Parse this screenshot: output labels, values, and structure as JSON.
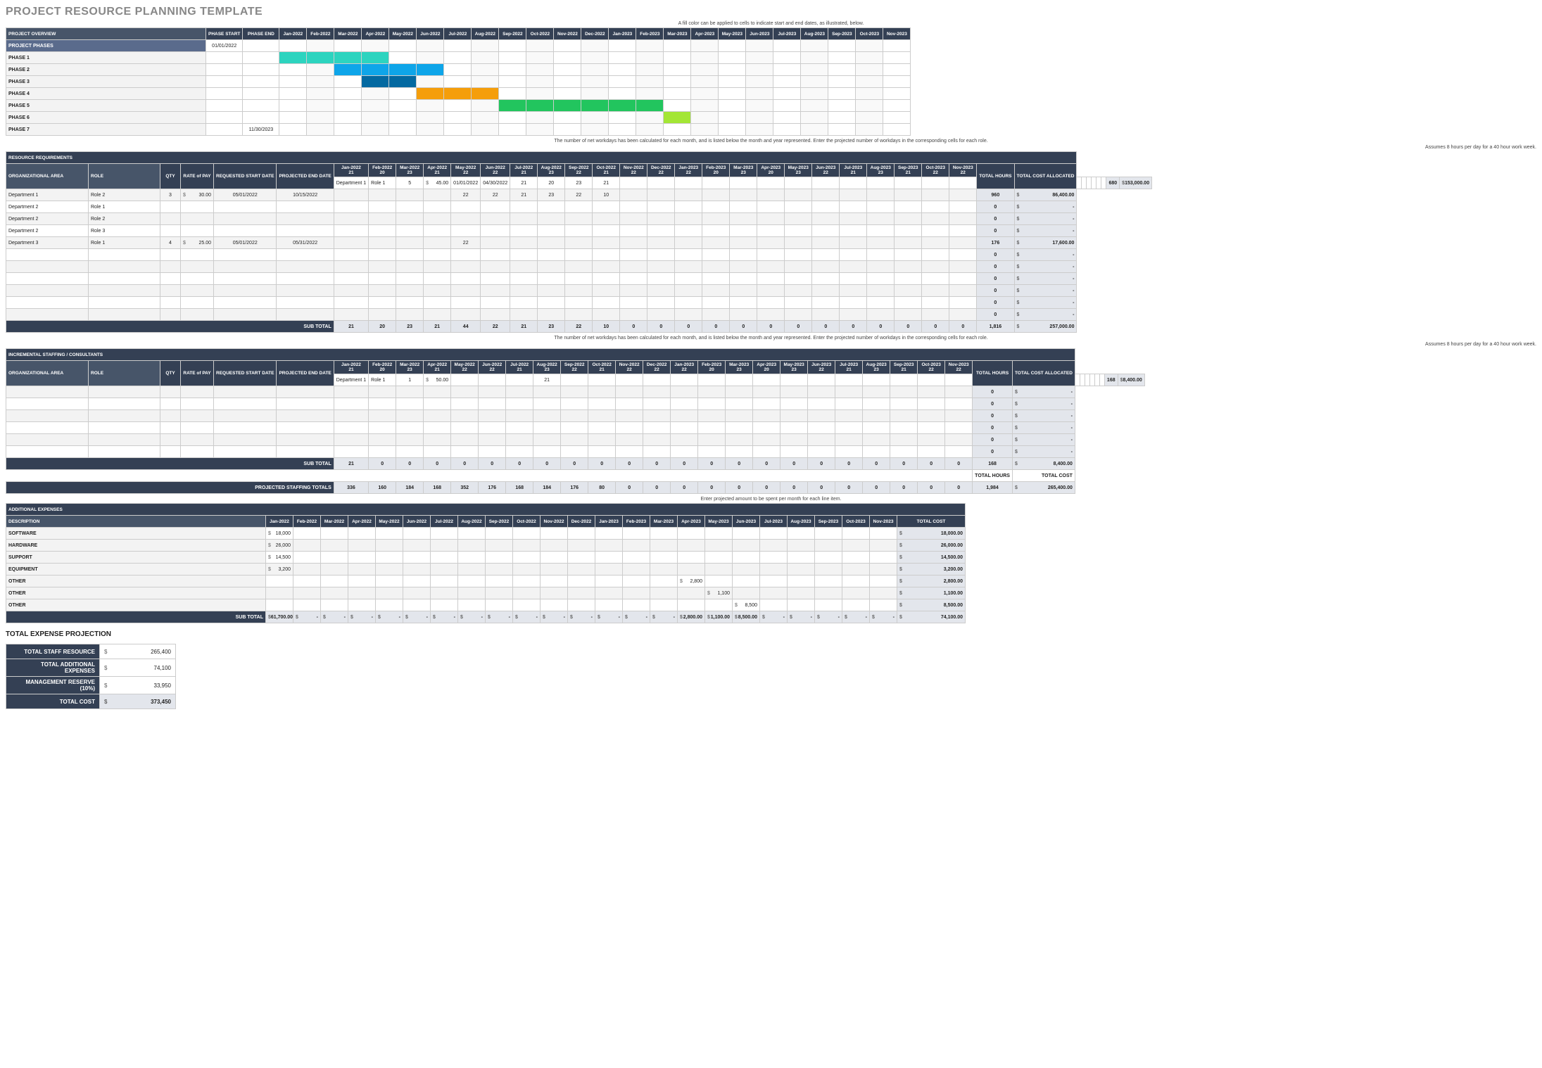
{
  "title": "PROJECT RESOURCE PLANNING TEMPLATE",
  "cap1": "A fill color can be applied to cells to indicate start and end dates, as illustrated, below.",
  "cap2": "The number of net workdays has been calculated for each month, and is listed below the month and year represented. Enter the projected number of workdays in the corresponding cells for each role.",
  "cap2r": "Assumes 8 hours per day for a 40 hour work week.",
  "cap3": "Enter projected amount to be spent per month for each line item.",
  "months": [
    "Jan-2022",
    "Feb-2022",
    "Mar-2022",
    "Apr-2022",
    "May-2022",
    "Jun-2022",
    "Jul-2022",
    "Aug-2022",
    "Sep-2022",
    "Oct-2022",
    "Nov-2022",
    "Dec-2022",
    "Jan-2023",
    "Feb-2023",
    "Mar-2023",
    "Apr-2023",
    "May-2023",
    "Jun-2023",
    "Jul-2023",
    "Aug-2023",
    "Sep-2023",
    "Oct-2023",
    "Nov-2023"
  ],
  "workdays": [
    "21",
    "20",
    "23",
    "21",
    "22",
    "22",
    "21",
    "23",
    "22",
    "21",
    "22",
    "22",
    "22",
    "20",
    "23",
    "20",
    "23",
    "22",
    "21",
    "23",
    "21",
    "22",
    "22"
  ],
  "workdays2": [
    "21",
    "20",
    "23",
    "21",
    "22",
    "22",
    "21",
    "23",
    "22",
    "21",
    "22",
    "22",
    "22",
    "20",
    "23",
    "20",
    "23",
    "22",
    "21",
    "23",
    "21",
    "22",
    "22"
  ],
  "gantt": {
    "header": [
      "PROJECT OVERVIEW",
      "PHASE START",
      "PHASE END"
    ],
    "rows": [
      {
        "label": "PROJECT PHASES",
        "start": "01/01/2022",
        "end": "",
        "bar": null,
        "title": true
      },
      {
        "label": "PHASE 1",
        "start": "",
        "end": "",
        "bar": {
          "cls": "bar-teal",
          "from": 0,
          "to": 3
        }
      },
      {
        "label": "PHASE 2",
        "start": "",
        "end": "",
        "bar": {
          "cls": "bar-blue",
          "from": 2,
          "to": 5
        }
      },
      {
        "label": "PHASE 3",
        "start": "",
        "end": "",
        "bar": {
          "cls": "bar-dblue",
          "from": 3,
          "to": 4
        }
      },
      {
        "label": "PHASE 4",
        "start": "",
        "end": "",
        "bar": {
          "cls": "bar-orange",
          "from": 5,
          "to": 7
        }
      },
      {
        "label": "PHASE 5",
        "start": "",
        "end": "",
        "bar": {
          "cls": "bar-green",
          "from": 8,
          "to": 13
        }
      },
      {
        "label": "PHASE 6",
        "start": "",
        "end": "",
        "bar": {
          "cls": "bar-lgreen",
          "from": 14,
          "to": 14
        }
      },
      {
        "label": "PHASE 7",
        "start": "",
        "end": "11/30/2023",
        "bar": null
      }
    ]
  },
  "res": {
    "title": "RESOURCE REQUIREMENTS",
    "cols": [
      "ORGANIZATIONAL AREA",
      "ROLE",
      "QTY",
      "RATE of PAY",
      "REQUESTED START DATE",
      "PROJECTED END DATE"
    ],
    "tot_hdr": [
      "TOTAL HOURS",
      "TOTAL COST ALLOCATED"
    ],
    "rows": [
      {
        "area": "Department 1",
        "role": "Role 1",
        "qty": "5",
        "rate": "45.00",
        "rs": "01/01/2022",
        "re": "04/30/2022",
        "m": [
          "21",
          "20",
          "23",
          "21",
          "",
          "",
          "",
          "",
          "",
          "",
          "",
          "",
          "",
          "",
          "",
          "",
          "",
          "",
          "",
          "",
          "",
          "",
          ""
        ],
        "hrs": "680",
        "cost": "153,000.00"
      },
      {
        "area": "Department 1",
        "role": "Role 2",
        "qty": "3",
        "rate": "30.00",
        "rs": "05/01/2022",
        "re": "10/15/2022",
        "m": [
          "",
          "",
          "",
          "",
          "22",
          "22",
          "21",
          "23",
          "22",
          "10",
          "",
          "",
          "",
          "",
          "",
          "",
          "",
          "",
          "",
          "",
          "",
          "",
          ""
        ],
        "hrs": "960",
        "cost": "86,400.00"
      },
      {
        "area": "Department 2",
        "role": "Role 1",
        "qty": "",
        "rate": "",
        "rs": "",
        "re": "",
        "m": [
          "",
          "",
          "",
          "",
          "",
          "",
          "",
          "",
          "",
          "",
          "",
          "",
          "",
          "",
          "",
          "",
          "",
          "",
          "",
          "",
          "",
          "",
          ""
        ],
        "hrs": "0",
        "cost": "-"
      },
      {
        "area": "Department 2",
        "role": "Role 2",
        "qty": "",
        "rate": "",
        "rs": "",
        "re": "",
        "m": [
          "",
          "",
          "",
          "",
          "",
          "",
          "",
          "",
          "",
          "",
          "",
          "",
          "",
          "",
          "",
          "",
          "",
          "",
          "",
          "",
          "",
          "",
          ""
        ],
        "hrs": "0",
        "cost": "-"
      },
      {
        "area": "Department 2",
        "role": "Role 3",
        "qty": "",
        "rate": "",
        "rs": "",
        "re": "",
        "m": [
          "",
          "",
          "",
          "",
          "",
          "",
          "",
          "",
          "",
          "",
          "",
          "",
          "",
          "",
          "",
          "",
          "",
          "",
          "",
          "",
          "",
          "",
          ""
        ],
        "hrs": "0",
        "cost": "-"
      },
      {
        "area": "Department 3",
        "role": "Role 1",
        "qty": "4",
        "rate": "25.00",
        "rs": "05/01/2022",
        "re": "05/31/2022",
        "m": [
          "",
          "",
          "",
          "",
          "22",
          "",
          "",
          "",
          "",
          "",
          "",
          "",
          "",
          "",
          "",
          "",
          "",
          "",
          "",
          "",
          "",
          "",
          ""
        ],
        "hrs": "176",
        "cost": "17,600.00"
      },
      {
        "area": "",
        "role": "",
        "qty": "",
        "rate": "",
        "rs": "",
        "re": "",
        "m": [
          "",
          "",
          "",
          "",
          "",
          "",
          "",
          "",
          "",
          "",
          "",
          "",
          "",
          "",
          "",
          "",
          "",
          "",
          "",
          "",
          "",
          "",
          ""
        ],
        "hrs": "0",
        "cost": "-"
      },
      {
        "area": "",
        "role": "",
        "qty": "",
        "rate": "",
        "rs": "",
        "re": "",
        "m": [
          "",
          "",
          "",
          "",
          "",
          "",
          "",
          "",
          "",
          "",
          "",
          "",
          "",
          "",
          "",
          "",
          "",
          "",
          "",
          "",
          "",
          "",
          ""
        ],
        "hrs": "0",
        "cost": "-"
      },
      {
        "area": "",
        "role": "",
        "qty": "",
        "rate": "",
        "rs": "",
        "re": "",
        "m": [
          "",
          "",
          "",
          "",
          "",
          "",
          "",
          "",
          "",
          "",
          "",
          "",
          "",
          "",
          "",
          "",
          "",
          "",
          "",
          "",
          "",
          "",
          ""
        ],
        "hrs": "0",
        "cost": "-"
      },
      {
        "area": "",
        "role": "",
        "qty": "",
        "rate": "",
        "rs": "",
        "re": "",
        "m": [
          "",
          "",
          "",
          "",
          "",
          "",
          "",
          "",
          "",
          "",
          "",
          "",
          "",
          "",
          "",
          "",
          "",
          "",
          "",
          "",
          "",
          "",
          ""
        ],
        "hrs": "0",
        "cost": "-"
      },
      {
        "area": "",
        "role": "",
        "qty": "",
        "rate": "",
        "rs": "",
        "re": "",
        "m": [
          "",
          "",
          "",
          "",
          "",
          "",
          "",
          "",
          "",
          "",
          "",
          "",
          "",
          "",
          "",
          "",
          "",
          "",
          "",
          "",
          "",
          "",
          ""
        ],
        "hrs": "0",
        "cost": "-"
      },
      {
        "area": "",
        "role": "",
        "qty": "",
        "rate": "",
        "rs": "",
        "re": "",
        "m": [
          "",
          "",
          "",
          "",
          "",
          "",
          "",
          "",
          "",
          "",
          "",
          "",
          "",
          "",
          "",
          "",
          "",
          "",
          "",
          "",
          "",
          "",
          ""
        ],
        "hrs": "0",
        "cost": "-"
      }
    ],
    "sub_label": "SUB TOTAL",
    "sub": [
      "21",
      "20",
      "23",
      "21",
      "44",
      "22",
      "21",
      "23",
      "22",
      "10",
      "0",
      "0",
      "0",
      "0",
      "0",
      "0",
      "0",
      "0",
      "0",
      "0",
      "0",
      "0",
      "0"
    ],
    "sub_hrs": "1,816",
    "sub_cost": "257,000.00"
  },
  "inc": {
    "title": "INCREMENTAL STAFFING / CONSULTANTS",
    "rows": [
      {
        "area": "Department 1",
        "role": "Role 1",
        "qty": "1",
        "rate": "50.00",
        "rs": "",
        "re": "",
        "m": [
          "",
          "21",
          "",
          "",
          "",
          "",
          "",
          "",
          "",
          "",
          "",
          "",
          "",
          "",
          "",
          "",
          "",
          "",
          "",
          "",
          "",
          "",
          ""
        ],
        "hrs": "168",
        "cost": "8,400.00"
      },
      {
        "area": "",
        "role": "",
        "qty": "",
        "rate": "",
        "rs": "",
        "re": "",
        "m": [
          "",
          "",
          "",
          "",
          "",
          "",
          "",
          "",
          "",
          "",
          "",
          "",
          "",
          "",
          "",
          "",
          "",
          "",
          "",
          "",
          "",
          "",
          ""
        ],
        "hrs": "0",
        "cost": "-"
      },
      {
        "area": "",
        "role": "",
        "qty": "",
        "rate": "",
        "rs": "",
        "re": "",
        "m": [
          "",
          "",
          "",
          "",
          "",
          "",
          "",
          "",
          "",
          "",
          "",
          "",
          "",
          "",
          "",
          "",
          "",
          "",
          "",
          "",
          "",
          "",
          ""
        ],
        "hrs": "0",
        "cost": "-"
      },
      {
        "area": "",
        "role": "",
        "qty": "",
        "rate": "",
        "rs": "",
        "re": "",
        "m": [
          "",
          "",
          "",
          "",
          "",
          "",
          "",
          "",
          "",
          "",
          "",
          "",
          "",
          "",
          "",
          "",
          "",
          "",
          "",
          "",
          "",
          "",
          ""
        ],
        "hrs": "0",
        "cost": "-"
      },
      {
        "area": "",
        "role": "",
        "qty": "",
        "rate": "",
        "rs": "",
        "re": "",
        "m": [
          "",
          "",
          "",
          "",
          "",
          "",
          "",
          "",
          "",
          "",
          "",
          "",
          "",
          "",
          "",
          "",
          "",
          "",
          "",
          "",
          "",
          "",
          ""
        ],
        "hrs": "0",
        "cost": "-"
      },
      {
        "area": "",
        "role": "",
        "qty": "",
        "rate": "",
        "rs": "",
        "re": "",
        "m": [
          "",
          "",
          "",
          "",
          "",
          "",
          "",
          "",
          "",
          "",
          "",
          "",
          "",
          "",
          "",
          "",
          "",
          "",
          "",
          "",
          "",
          "",
          ""
        ],
        "hrs": "0",
        "cost": "-"
      },
      {
        "area": "",
        "role": "",
        "qty": "",
        "rate": "",
        "rs": "",
        "re": "",
        "m": [
          "",
          "",
          "",
          "",
          "",
          "",
          "",
          "",
          "",
          "",
          "",
          "",
          "",
          "",
          "",
          "",
          "",
          "",
          "",
          "",
          "",
          "",
          ""
        ],
        "hrs": "0",
        "cost": "-"
      }
    ],
    "sub_label": "SUB TOTAL",
    "sub": [
      "21",
      "0",
      "0",
      "0",
      "0",
      "0",
      "0",
      "0",
      "0",
      "0",
      "0",
      "0",
      "0",
      "0",
      "0",
      "0",
      "0",
      "0",
      "0",
      "0",
      "0",
      "0",
      "0"
    ],
    "sub_hrs": "168",
    "sub_cost": "8,400.00",
    "grand_lbls": [
      "TOTAL HOURS",
      "TOTAL COST"
    ],
    "proj_label": "PROJECTED STAFFING TOTALS",
    "proj": [
      "336",
      "160",
      "184",
      "168",
      "352",
      "176",
      "168",
      "184",
      "176",
      "80",
      "0",
      "0",
      "0",
      "0",
      "0",
      "0",
      "0",
      "0",
      "0",
      "0",
      "0",
      "0",
      "0"
    ],
    "proj_hrs": "1,984",
    "proj_cost": "265,400.00"
  },
  "exp": {
    "title": "ADDITIONAL EXPENSES",
    "desc": "DESCRIPTION",
    "tc": "TOTAL COST",
    "rows": [
      {
        "d": "SOFTWARE",
        "m": [
          "18,000",
          "",
          "",
          "",
          "",
          "",
          "",
          "",
          "",
          "",
          "",
          "",
          "",
          "",
          "",
          "",
          "",
          "",
          "",
          "",
          "",
          "",
          ""
        ],
        "tot": "18,000.00"
      },
      {
        "d": "HARDWARE",
        "m": [
          "26,000",
          "",
          "",
          "",
          "",
          "",
          "",
          "",
          "",
          "",
          "",
          "",
          "",
          "",
          "",
          "",
          "",
          "",
          "",
          "",
          "",
          "",
          ""
        ],
        "tot": "26,000.00"
      },
      {
        "d": "SUPPORT",
        "m": [
          "14,500",
          "",
          "",
          "",
          "",
          "",
          "",
          "",
          "",
          "",
          "",
          "",
          "",
          "",
          "",
          "",
          "",
          "",
          "",
          "",
          "",
          "",
          ""
        ],
        "tot": "14,500.00"
      },
      {
        "d": "EQUIPMENT",
        "m": [
          "3,200",
          "",
          "",
          "",
          "",
          "",
          "",
          "",
          "",
          "",
          "",
          "",
          "",
          "",
          "",
          "",
          "",
          "",
          "",
          "",
          "",
          "",
          ""
        ],
        "tot": "3,200.00"
      },
      {
        "d": "OTHER",
        "m": [
          "",
          "",
          "",
          "",
          "",
          "",
          "",
          "",
          "",
          "",
          "",
          "",
          "",
          "",
          "",
          "2,800",
          "",
          "",
          "",
          "",
          "",
          "",
          ""
        ],
        "tot": "2,800.00"
      },
      {
        "d": "OTHER",
        "m": [
          "",
          "",
          "",
          "",
          "",
          "",
          "",
          "",
          "",
          "",
          "",
          "",
          "",
          "",
          "",
          "",
          "1,100",
          "",
          "",
          "",
          "",
          "",
          ""
        ],
        "tot": "1,100.00"
      },
      {
        "d": "OTHER",
        "m": [
          "",
          "",
          "",
          "",
          "",
          "",
          "",
          "",
          "",
          "",
          "",
          "",
          "",
          "",
          "",
          "",
          "",
          "8,500",
          "",
          "",
          "",
          "",
          ""
        ],
        "tot": "8,500.00"
      }
    ],
    "sub_label": "SUB TOTAL",
    "sub": [
      "61,700.00",
      "-",
      "-",
      "-",
      "-",
      "-",
      "-",
      "-",
      "-",
      "-",
      "-",
      "-",
      "-",
      "-",
      "-",
      "2,800.00",
      "1,100.00",
      "8,500.00",
      "-",
      "-",
      "-",
      "-",
      "-"
    ],
    "sub_tot": "74,100.00"
  },
  "sum": {
    "title": "TOTAL EXPENSE PROJECTION",
    "rows": [
      {
        "l": "TOTAL STAFF RESOURCE",
        "v": "265,400"
      },
      {
        "l": "TOTAL ADDITIONAL EXPENSES",
        "v": "74,100"
      },
      {
        "l": "MANAGEMENT RESERVE (10%)",
        "v": "33,950"
      },
      {
        "l": "TOTAL COST",
        "v": "373,450",
        "b": true
      }
    ]
  },
  "colw": {
    "area": 110,
    "role": 95,
    "qty": 22,
    "rate": 40,
    "date": 45,
    "month": 32,
    "tot": 40,
    "cost": 50
  }
}
